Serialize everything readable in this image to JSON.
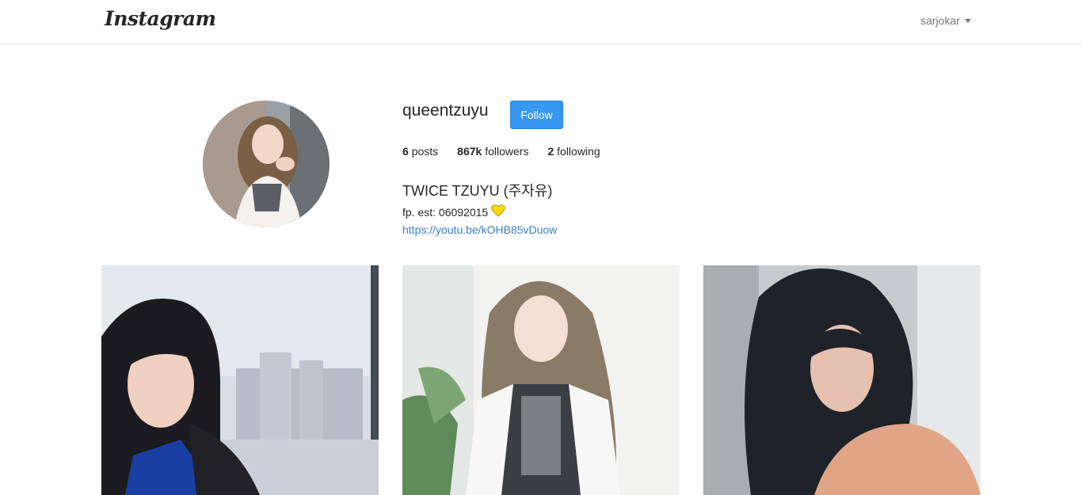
{
  "navbar": {
    "logo_text": "Instagram",
    "user_name": "sarjokar"
  },
  "profile": {
    "username": "queentzuyu",
    "follow_label": "Follow",
    "stats": [
      {
        "value": "6",
        "label": "posts"
      },
      {
        "value": "867k",
        "label": "followers"
      },
      {
        "value": "2",
        "label": "following"
      }
    ],
    "full_name": "TWICE TZUYU (주자유)",
    "bio": "fp. est: 06092015",
    "link": "https://youtu.be/kOHB85vDuow"
  },
  "posts": [
    {
      "icon": "photo"
    },
    {
      "icon": "photo"
    },
    {
      "icon": "photo"
    }
  ],
  "colors": {
    "follow_button": "#3897f0",
    "link": "#3a7fc1",
    "heart": "#f5d90a"
  }
}
